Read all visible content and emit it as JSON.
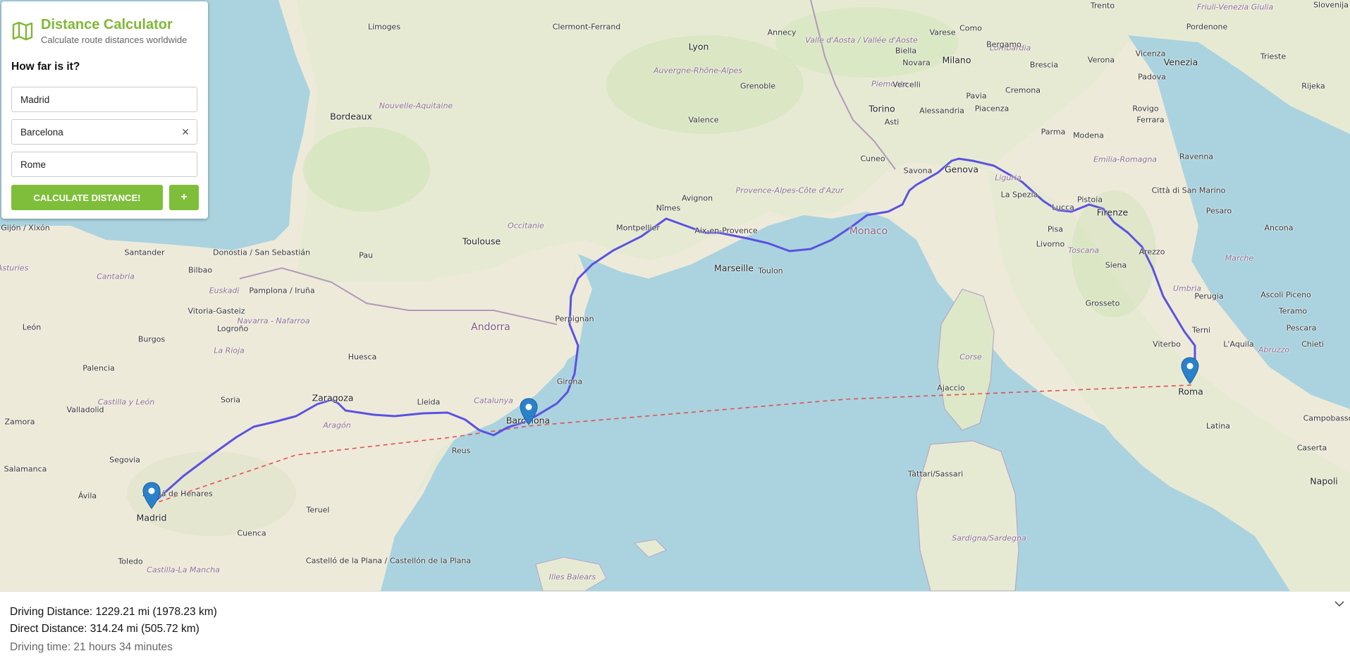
{
  "app": {
    "title": "Distance Calculator",
    "subtitle": "Calculate route distances worldwide",
    "question": "How far is it?",
    "icon": "map-icon",
    "accent_color": "#7fbe3a"
  },
  "inputs": [
    {
      "value": "Madrid",
      "clearable": false
    },
    {
      "value": "Barcelona",
      "clearable": true
    },
    {
      "value": "Rome",
      "clearable": false
    }
  ],
  "buttons": {
    "calculate": "CALCULATE DISTANCE!",
    "add": "+"
  },
  "results": {
    "driving": "Driving Distance: 1229.21 mi (1978.23 km)",
    "direct": "Direct Distance: 314.24 mi (505.72 km)",
    "time": "Driving time: 21 hours 34 minutes"
  },
  "map": {
    "route_color": "#5b52e0",
    "direct_line_color": "#e05252",
    "markers": [
      "Madrid",
      "Barcelona",
      "Roma"
    ],
    "labels": [
      "Limoges",
      "Clermont-Ferrand",
      "Annecy",
      "Lyon",
      "Auvergne-Rhône-Alpes",
      "Grenoble",
      "Valence",
      "Bordeaux",
      "Nouvelle-Aquitaine",
      "Toulouse",
      "Occitanie",
      "Nîmes",
      "Avignon",
      "Montpellier",
      "Aix-en-Provence",
      "Marseille",
      "Toulon",
      "Provence-Alpes-Côte d'Azur",
      "Monaco",
      "Perpignan",
      "Andorra",
      "Pau",
      "Pamplona / Iruña",
      "Donostia / San Sebastián",
      "Bilbao",
      "Santander",
      "Gijón / Xixón",
      "Asturies",
      "Cantabria",
      "Euskadi",
      "Vitoria-Gasteiz",
      "Logroño",
      "Navarra - Nafarroa",
      "León",
      "Burgos",
      "La Rioja",
      "Palencia",
      "Valladolid",
      "Castilla y León",
      "Soria",
      "Zamora",
      "Salamanca",
      "Segovia",
      "Ávila",
      "Alcalá de Henares",
      "Madrid",
      "Toledo",
      "Cuenca",
      "Castilla-La Mancha",
      "Teruel",
      "Zaragoza",
      "Aragón",
      "Huesca",
      "Lleida",
      "Catalunya",
      "Girona",
      "Barcelona",
      "Reus",
      "Castelló de la Plana / Castellón de la Plana",
      "Illes Balears",
      "Torino",
      "Piemonte",
      "Milano",
      "Lombardia",
      "Alessandria",
      "Asti",
      "Cuneo",
      "Savona",
      "Genova",
      "Liguria",
      "La Spezia",
      "Parma",
      "Modena",
      "Emilia-Romagna",
      "Bergamo",
      "Brescia",
      "Cremona",
      "Piacenza",
      "Pavia",
      "Vercelli",
      "Novara",
      "Biella",
      "Varese",
      "Como",
      "Verona",
      "Vicenza",
      "Padova",
      "Venezia",
      "Trieste",
      "Rovigo",
      "Ferrara",
      "Ravenna",
      "Pordenone",
      "Trento",
      "Città di San Marino",
      "Pesaro",
      "Ancona",
      "Marche",
      "Lucca",
      "Pistoia",
      "Firenze",
      "Toscana",
      "Pisa",
      "Livorno",
      "Arezzo",
      "Siena",
      "Grosseto",
      "Perugia",
      "Umbria",
      "Terni",
      "Viterbo",
      "Ascoli Piceno",
      "Teramo",
      "Pescara",
      "L'Aquila",
      "Abruzzo",
      "Chieti",
      "Roma",
      "Latina",
      "Campobasso",
      "Caserta",
      "Napoli",
      "Corse",
      "Ajaccio",
      "Sardigna/Sardegna",
      "Tàttari/Sassari",
      "Valle d'Aosta / Vallée d'Aoste",
      "Rijeka",
      "Slovenija",
      "Friuli-Venezia Giulia"
    ]
  }
}
